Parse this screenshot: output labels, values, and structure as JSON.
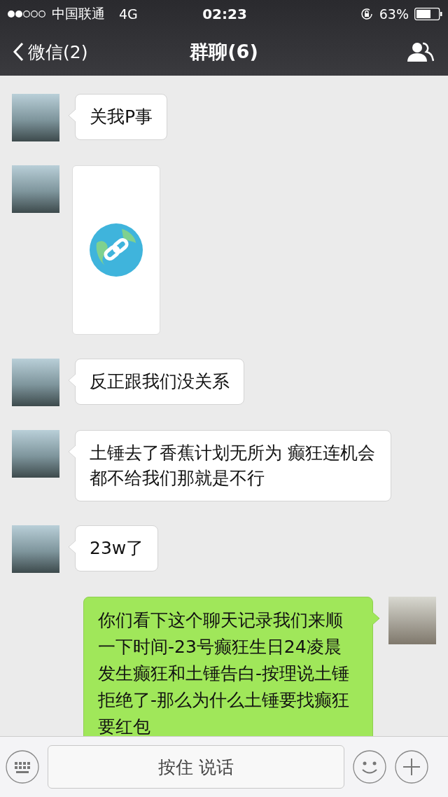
{
  "status_bar": {
    "carrier": "中国联通",
    "network": "4G",
    "time": "02:23",
    "battery": "63%"
  },
  "nav": {
    "back": "微信(2)",
    "title": "群聊(6)"
  },
  "messages": [
    {
      "kind": "text",
      "outgoing": false,
      "text": "关我P事"
    },
    {
      "kind": "image",
      "outgoing": false
    },
    {
      "kind": "text",
      "outgoing": false,
      "text": "反正跟我们没关系"
    },
    {
      "kind": "text",
      "outgoing": false,
      "text": "土锤去了香蕉计划无所为 癫狂连机会都不给我们那就是不行"
    },
    {
      "kind": "text",
      "outgoing": false,
      "text": "23w了"
    },
    {
      "kind": "text",
      "outgoing": true,
      "text": "你们看下这个聊天记录我们来顺一下时间-23号癫狂生日24凌晨发生癫狂和土锤告白-按理说土锤拒绝了-那么为什么土锤要找癫狂要红包"
    }
  ],
  "input": {
    "label": "按住 说话"
  }
}
